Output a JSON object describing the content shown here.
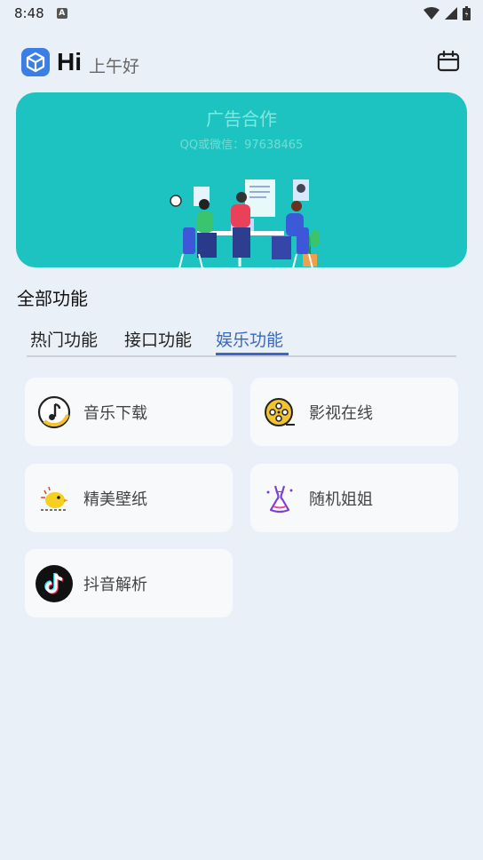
{
  "status_bar": {
    "time": "8:48",
    "notification_icon": "a-badge-icon"
  },
  "header": {
    "hi": "Hi",
    "greeting": "上午好"
  },
  "banner": {
    "title": "广告合作",
    "subtitle": "QQ或微信：97638465"
  },
  "section": {
    "title": "全部功能"
  },
  "tabs": [
    {
      "label": "热门功能",
      "active": false
    },
    {
      "label": "接口功能",
      "active": false
    },
    {
      "label": "娱乐功能",
      "active": true
    }
  ],
  "features": [
    {
      "label": "音乐下载",
      "icon": "music-note-icon"
    },
    {
      "label": "影视在线",
      "icon": "film-reel-icon"
    },
    {
      "label": "精美壁纸",
      "icon": "wallpaper-bird-icon"
    },
    {
      "label": "随机姐姐",
      "icon": "dress-icon"
    },
    {
      "label": "抖音解析",
      "icon": "tiktok-icon"
    }
  ],
  "colors": {
    "accent": "#3a67c4",
    "banner": "#1cc3c0",
    "background": "#eaf0f7"
  }
}
